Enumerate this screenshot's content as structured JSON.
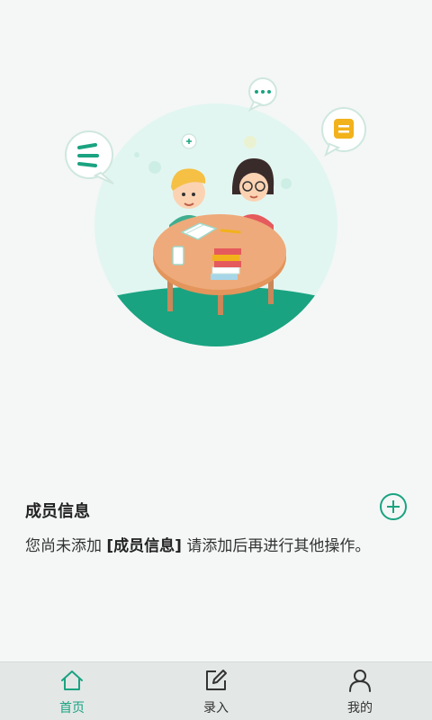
{
  "section": {
    "title": "成员信息",
    "message_before": "您尚未添加",
    "message_highlight": "[成员信息]",
    "message_after": "请添加后再进行其他操作。"
  },
  "tabs": [
    {
      "label": "首页",
      "icon": "home-icon",
      "active": true
    },
    {
      "label": "录入",
      "icon": "edit-icon",
      "active": false
    },
    {
      "label": "我的",
      "icon": "user-icon",
      "active": false
    }
  ],
  "colors": {
    "accent": "#1aa381",
    "circle_bg": "#e2f6f1",
    "table": "#eeaa7a",
    "tabbar_bg": "#e3e7e6"
  }
}
